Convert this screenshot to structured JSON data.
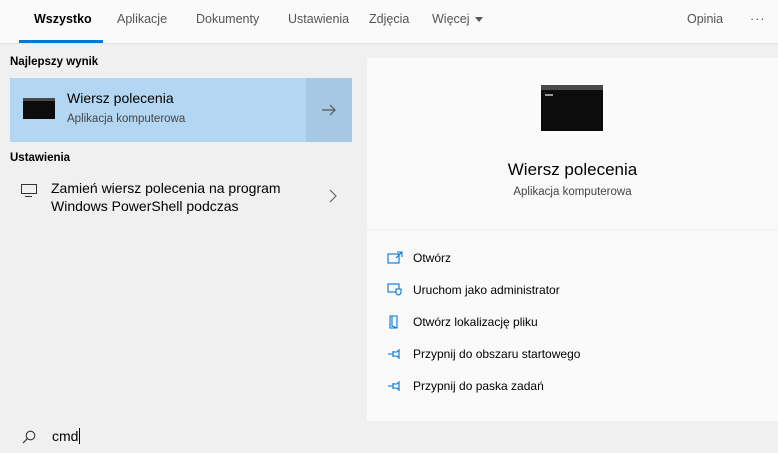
{
  "tabs": [
    {
      "label": "Wszystko",
      "active": true
    },
    {
      "label": "Aplikacje"
    },
    {
      "label": "Dokumenty"
    },
    {
      "label": "Ustawienia"
    },
    {
      "label": "Zdjęcia"
    },
    {
      "label": "Więcej"
    }
  ],
  "feedback_label": "Opinia",
  "more_options_label": "···",
  "left": {
    "best_header": "Najlepszy wynik",
    "best_result": {
      "title": "Wiersz polecenia",
      "subtitle": "Aplikacja komputerowa",
      "icon": "command-prompt-icon"
    },
    "settings_header": "Ustawienia",
    "setting_item": {
      "text": "Zamień wiersz polecenia na program Windows PowerShell podczas",
      "icon": "monitor-icon"
    }
  },
  "details": {
    "title": "Wiersz polecenia",
    "subtitle": "Aplikacja komputerowa",
    "actions": [
      {
        "label": "Otwórz",
        "icon": "open-icon"
      },
      {
        "label": "Uruchom jako administrator",
        "icon": "run-as-admin-icon"
      },
      {
        "label": "Otwórz lokalizację pliku",
        "icon": "file-location-icon"
      },
      {
        "label": "Przypnij do obszaru startowego",
        "icon": "pin-icon"
      },
      {
        "label": "Przypnij do paska zadań",
        "icon": "pin-icon"
      }
    ]
  },
  "search": {
    "value": "cmd"
  },
  "colors": {
    "accent": "#0078d7",
    "selected": "#b3d7f3"
  }
}
